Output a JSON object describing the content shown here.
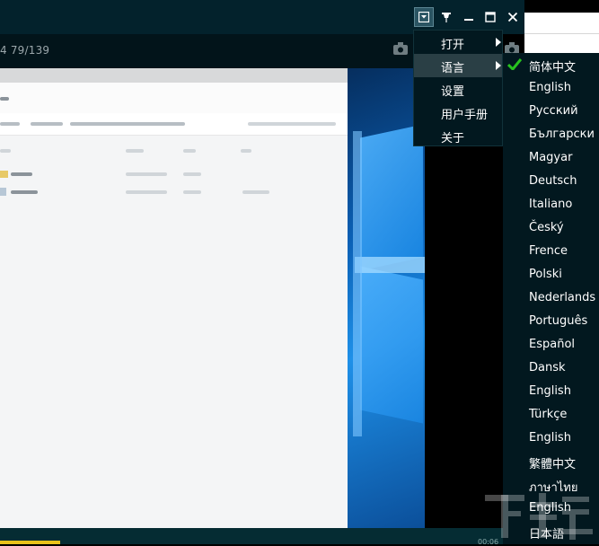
{
  "player": {
    "counter": "4 79/139",
    "time": "00:06",
    "progress_fraction": 0.12
  },
  "window_controls": {
    "menu": "menu-dropdown-icon",
    "pin": "pin-icon",
    "minimize": "minimize-icon",
    "maximize": "maximize-icon",
    "close": "close-icon"
  },
  "main_menu": {
    "items": [
      {
        "label": "打开",
        "has_submenu": true
      },
      {
        "label": "语言",
        "has_submenu": true,
        "highlighted": true
      },
      {
        "label": "设置",
        "has_submenu": false
      },
      {
        "label": "用户手册",
        "has_submenu": false
      },
      {
        "label": "关于",
        "has_submenu": false
      }
    ]
  },
  "language_menu": {
    "selected_index": 0,
    "items": [
      {
        "label": "简体中文"
      },
      {
        "label": "English"
      },
      {
        "label": "Русский"
      },
      {
        "label": "Български"
      },
      {
        "label": "Magyar"
      },
      {
        "label": "Deutsch"
      },
      {
        "label": "Italiano"
      },
      {
        "label": "Český"
      },
      {
        "label": "Frence"
      },
      {
        "label": "Polski"
      },
      {
        "label": "Nederlands"
      },
      {
        "label": "Português"
      },
      {
        "label": "Español"
      },
      {
        "label": "Dansk"
      },
      {
        "label": "English"
      },
      {
        "label": "Türkçe"
      },
      {
        "label": "English"
      },
      {
        "label": "繁體中文"
      },
      {
        "label": "ภาษาไทย"
      },
      {
        "label": "English"
      },
      {
        "label": "日本語"
      }
    ]
  },
  "colors": {
    "titlebar": "#03222c",
    "menu_bg": "#02181f",
    "menu_highlight": "#2a3f45",
    "check": "#27c21f",
    "progress": "#e9c21a"
  }
}
